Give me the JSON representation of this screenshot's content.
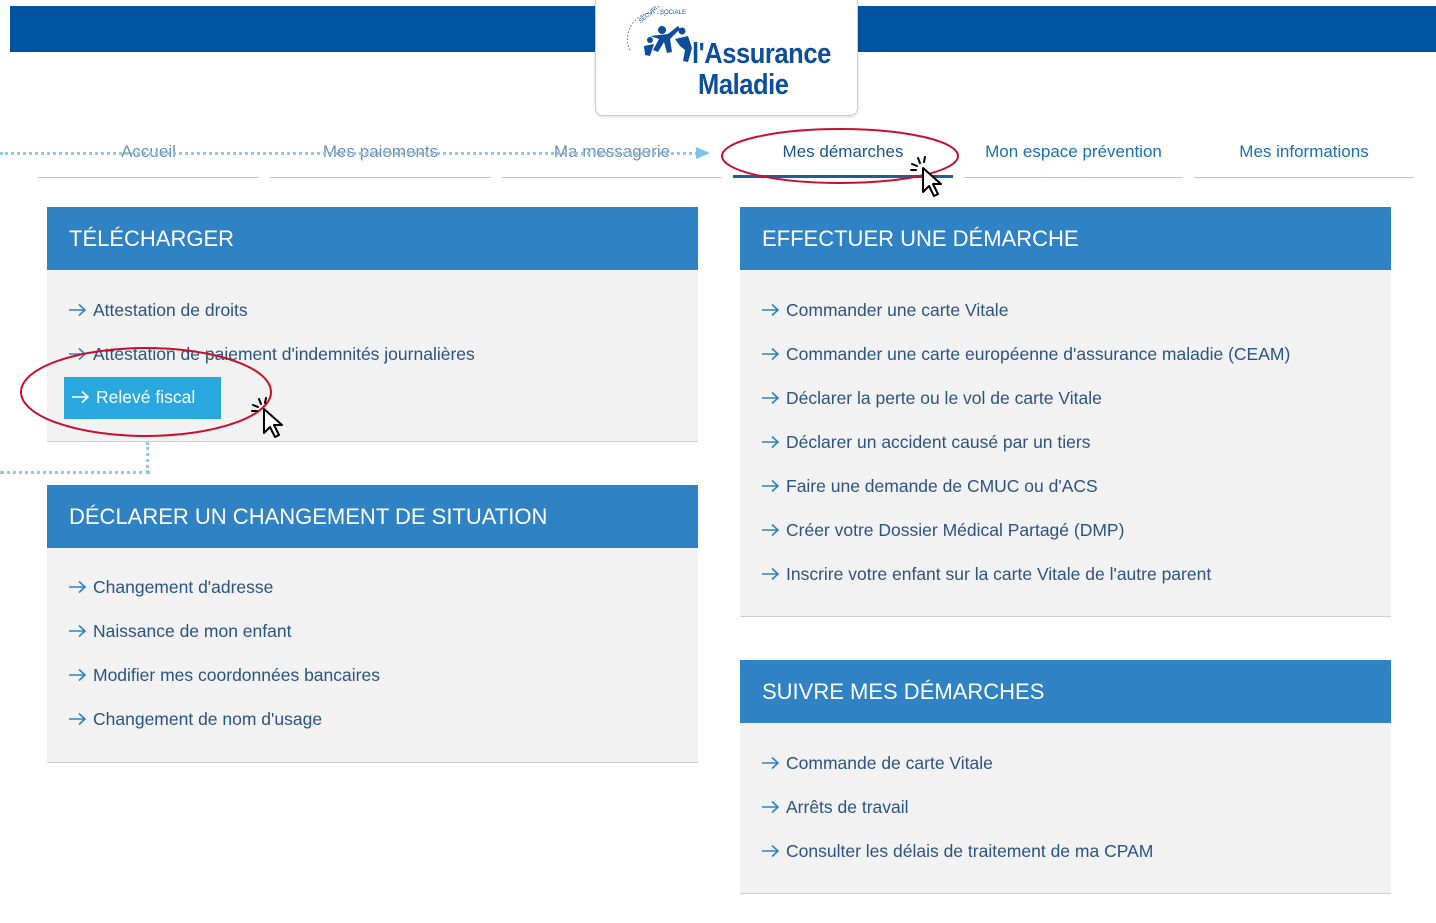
{
  "header": {
    "logo_line1": "l'Assurance",
    "logo_line2": "Maladie",
    "logo_seal_text": "SÉCURITÉ SOCIALE",
    "brand_color": "#00549f"
  },
  "nav": {
    "items": [
      {
        "label": "Accueil"
      },
      {
        "label": "Mes paiements"
      },
      {
        "label": "Ma messagerie"
      },
      {
        "label": "Mes démarches"
      },
      {
        "label": "Mon espace prévention"
      },
      {
        "label": "Mes informations"
      }
    ],
    "active": "Mes démarches"
  },
  "panels": {
    "telecharger": {
      "title": "TÉLÉCHARGER",
      "links": [
        "Attestation de droits",
        "Attestation de paiement d'indemnités journalières",
        "Relevé fiscal"
      ]
    },
    "changement": {
      "title": "DÉCLARER UN CHANGEMENT DE SITUATION",
      "links": [
        "Changement d'adresse",
        "Naissance de mon enfant",
        "Modifier mes coordonnées bancaires",
        "Changement de nom d'usage"
      ]
    },
    "demarche": {
      "title": "EFFECTUER UNE DÉMARCHE",
      "links": [
        "Commander une carte Vitale",
        "Commander une carte européenne d'assurance maladie (CEAM)",
        "Déclarer la perte ou le vol de carte Vitale",
        "Déclarer un accident causé par un tiers",
        "Faire une demande de CMUC ou d'ACS",
        "Créer votre Dossier Médical Partagé (DMP)",
        "Inscrire votre enfant sur la carte Vitale de l'autre parent"
      ]
    },
    "suivre": {
      "title": "SUIVRE MES DÉMARCHES",
      "links": [
        "Commande de carte Vitale",
        "Arrêts de travail",
        "Consulter les délais de traitement de ma CPAM"
      ]
    }
  },
  "colors": {
    "panel_header": "#2f83c4",
    "highlight_button": "#29a8e0",
    "annotation_ring": "#c8102e",
    "guide_dots": "#8ec9e9"
  }
}
